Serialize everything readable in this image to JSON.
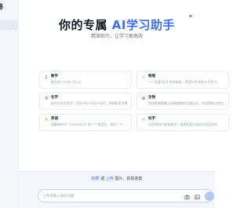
{
  "sidebar": {
    "logo_text": "卷"
  },
  "hero": {
    "title_prefix": "你的专属",
    "title_accent": "AI学习助手",
    "sparkle": "✦",
    "subtitle": "精准助力，让学习更高效"
  },
  "subjects": [
    {
      "icon": "Σ",
      "color": "#3d6df2",
      "title": "数学",
      "desc": "解方程 x²+4x-12=0"
    },
    {
      "icon": "⚡",
      "color": "#8b5cf6",
      "title": "物理",
      "desc": "一个质量为2千克的物体，受到10牛顿的水平拉力"
    },
    {
      "icon": "⚗",
      "color": "#16a34a",
      "title": "化学",
      "desc": "配平化学方程式：CH₄+O₂→CO₂+H₂O，说明配平步骤"
    },
    {
      "icon": "✿",
      "color": "#3d6df2",
      "title": "生物",
      "desc": "简述植物细胞与动物细胞的主要区别，并说明各自特点"
    },
    {
      "icon": "A",
      "color": "#f59e0b",
      "title": "英语",
      "desc": "请解释单词 \"innovative\" 的一个常用句，请用一个..."
    },
    {
      "icon": "⚛",
      "color": "#16a34a",
      "title": "科学",
      "desc": "太阳系的行星有哪些？请按距离太阳由近到远排列"
    }
  ],
  "bottom": {
    "hint_link_photo": "拍照",
    "hint_or": " 或 ",
    "hint_link_upload": "上传",
    "hint_rest": " 图片，获取答案",
    "input_placeholder": "上传或输入你的问题"
  },
  "colors": {
    "accent": "#3d6df2",
    "send_button": "#b6c8f5"
  },
  "icons": {
    "camera": "camera-icon",
    "image": "image-icon",
    "send": "send-icon"
  }
}
